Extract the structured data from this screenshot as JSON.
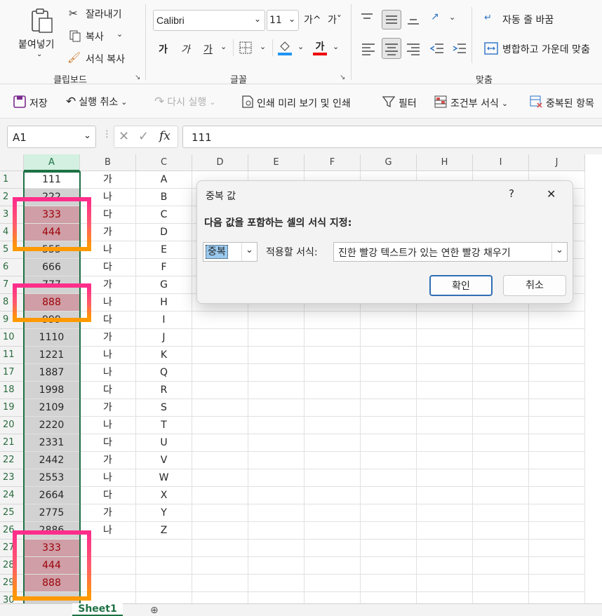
{
  "ribbon": {
    "clipboard": {
      "paste": "붙여넣기",
      "cut": "잘라내기",
      "copy": "복사",
      "format_painter": "서식 복사",
      "group_label": "클립보드"
    },
    "font": {
      "name": "Calibri",
      "size": "11",
      "grow": "가^",
      "shrink": "가ˇ",
      "bold": "가",
      "italic": "가",
      "underline": "가",
      "font_color_glyph": "가",
      "group_label": "글꼴"
    },
    "align": {
      "wrap_text": "자동 줄 바꿈",
      "merge_center": "병합하고 가운데 맞춤",
      "group_label": "맞춤"
    }
  },
  "qat": {
    "save": "저장",
    "undo": "실행 취소",
    "redo": "다시 실행",
    "print_preview": "인쇄 미리 보기 및 인쇄",
    "filter": "필터",
    "conditional_format": "조건부 서식",
    "remove_duplicates": "중복된 항목"
  },
  "formula_bar": {
    "name_box": "A1",
    "fx": "fx",
    "value": "111"
  },
  "columns": [
    "A",
    "B",
    "C",
    "D",
    "E",
    "F",
    "G",
    "H",
    "I",
    "J"
  ],
  "rows": [
    {
      "n": "1",
      "a": "111",
      "b": "가",
      "c": "A"
    },
    {
      "n": "2",
      "a": "222",
      "b": "나",
      "c": "B"
    },
    {
      "n": "3",
      "a": "333",
      "b": "다",
      "c": "C"
    },
    {
      "n": "4",
      "a": "444",
      "b": "가",
      "c": "D"
    },
    {
      "n": "5",
      "a": "555",
      "b": "나",
      "c": "E"
    },
    {
      "n": "6",
      "a": "666",
      "b": "다",
      "c": "F"
    },
    {
      "n": "7",
      "a": "777",
      "b": "가",
      "c": "G"
    },
    {
      "n": "8",
      "a": "888",
      "b": "나",
      "c": "H"
    },
    {
      "n": "9",
      "a": "999",
      "b": "다",
      "c": "I"
    },
    {
      "n": "10",
      "a": "1110",
      "b": "가",
      "c": "J"
    },
    {
      "n": "11",
      "a": "1221",
      "b": "나",
      "c": "K"
    },
    {
      "n": "17",
      "a": "1887",
      "b": "나",
      "c": "Q"
    },
    {
      "n": "18",
      "a": "1998",
      "b": "다",
      "c": "R"
    },
    {
      "n": "19",
      "a": "2109",
      "b": "가",
      "c": "S"
    },
    {
      "n": "20",
      "a": "2220",
      "b": "나",
      "c": "T"
    },
    {
      "n": "21",
      "a": "2331",
      "b": "다",
      "c": "U"
    },
    {
      "n": "22",
      "a": "2442",
      "b": "가",
      "c": "V"
    },
    {
      "n": "23",
      "a": "2553",
      "b": "나",
      "c": "W"
    },
    {
      "n": "24",
      "a": "2664",
      "b": "다",
      "c": "X"
    },
    {
      "n": "25",
      "a": "2775",
      "b": "가",
      "c": "Y"
    },
    {
      "n": "26",
      "a": "2886",
      "b": "나",
      "c": "Z"
    },
    {
      "n": "27",
      "a": "333",
      "b": "",
      "c": ""
    },
    {
      "n": "28",
      "a": "444",
      "b": "",
      "c": ""
    },
    {
      "n": "29",
      "a": "888",
      "b": "",
      "c": ""
    },
    {
      "n": "30",
      "a": "",
      "b": "",
      "c": ""
    }
  ],
  "duplicate_rows": [
    2,
    3,
    7,
    21,
    22,
    23
  ],
  "dialog": {
    "title": "중복 값",
    "help": "?",
    "close": "✕",
    "instruction": "다음 값을 포함하는 셀의 서식 지정:",
    "type_value": "중복",
    "apply_label": "적용할 서식:",
    "format_value": "진한 빨강 텍스트가 있는 연한 빨강 채우기",
    "ok": "확인",
    "cancel": "취소"
  },
  "sheet_tab": "Sheet1",
  "colors": {
    "excel_green": "#1e7145",
    "dup_fill": "#cf9ea6",
    "dup_text": "#9c0006",
    "highlight_start": "#ff2d8a",
    "highlight_end": "#ff9a00"
  }
}
